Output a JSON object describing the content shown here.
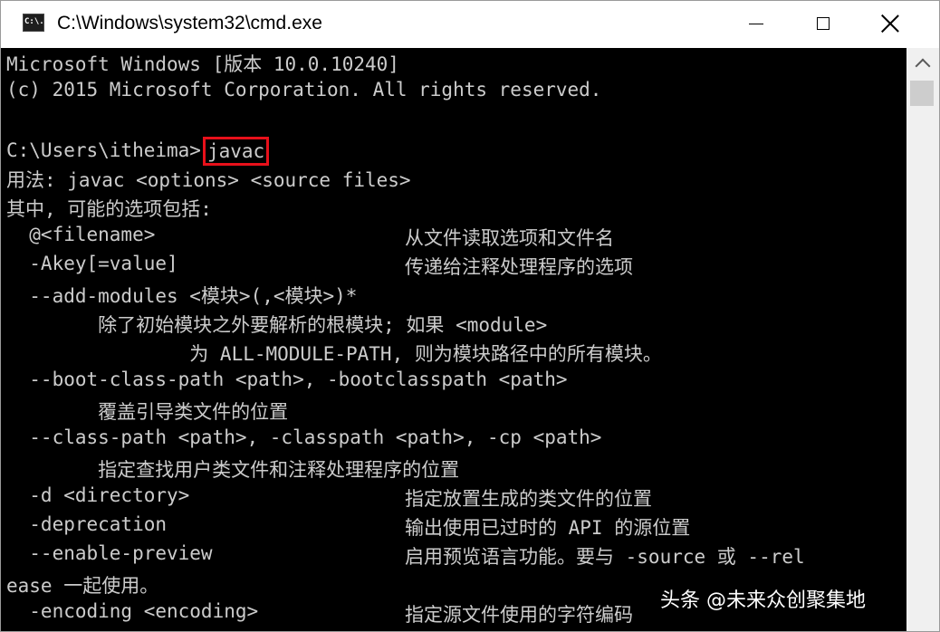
{
  "window": {
    "title": "C:\\Windows\\system32\\cmd.exe",
    "icon_name": "cmd-icon",
    "icon_text": "C:\\."
  },
  "console": {
    "header1": "Microsoft Windows [版本 10.0.10240]",
    "header2": "(c) 2015 Microsoft Corporation. All rights reserved.",
    "prompt": "C:\\Users\\itheima>",
    "command": "javac",
    "usage": "用法: javac <options> <source files>",
    "options_intro": "其中, 可能的选项包括:",
    "options": [
      {
        "opt": "  @<filename>",
        "desc": "从文件读取选项和文件名"
      },
      {
        "opt": "  -Akey[=value]",
        "desc": "传递给注释处理程序的选项"
      },
      {
        "opt": "  --add-modules <模块>(,<模块>)*",
        "desc": ""
      },
      {
        "opt": "        除了初始模块之外要解析的根模块; 如果 <module>",
        "desc": ""
      },
      {
        "opt": "                为 ALL-MODULE-PATH, 则为模块路径中的所有模块。",
        "desc": ""
      },
      {
        "opt": "  --boot-class-path <path>, -bootclasspath <path>",
        "desc": ""
      },
      {
        "opt": "        覆盖引导类文件的位置",
        "desc": ""
      },
      {
        "opt": "  --class-path <path>, -classpath <path>, -cp <path>",
        "desc": ""
      },
      {
        "opt": "        指定查找用户类文件和注释处理程序的位置",
        "desc": ""
      },
      {
        "opt": "  -d <directory>",
        "desc": "指定放置生成的类文件的位置"
      },
      {
        "opt": "  -deprecation",
        "desc": "输出使用已过时的 API 的源位置"
      },
      {
        "opt": "  --enable-preview",
        "desc": "启用预览语言功能。要与 -source 或 --rel"
      },
      {
        "opt": "ease 一起使用。",
        "desc": ""
      },
      {
        "opt": "  -encoding <encoding>",
        "desc": "指定源文件使用的字符编码"
      }
    ]
  },
  "colors": {
    "console_bg": "#000000",
    "console_text": "#cccccc",
    "highlight_border": "#e8101a"
  },
  "watermark": "头条 @未来众创聚集地"
}
